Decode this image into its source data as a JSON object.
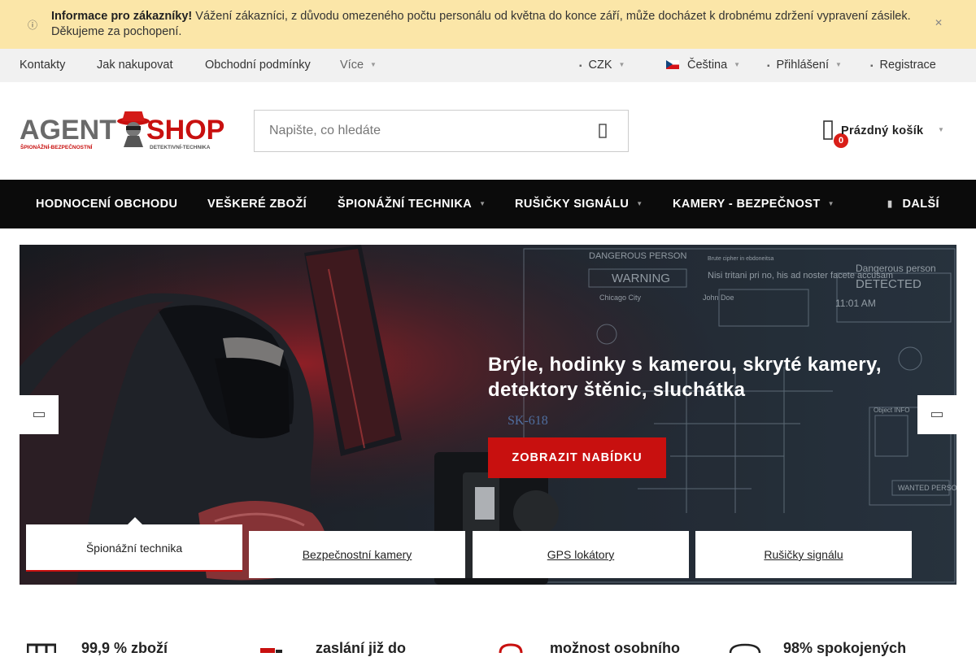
{
  "info_bar": {
    "title": "Informace pro zákazníky!",
    "message": "Vážení zákazníci, z důvodu omezeného počtu personálu od května do konce září, může docházet k drobnému zdržení vypravení zásilek. Děkujeme za pochopení.",
    "icon": "info-icon",
    "close_icon": "close-icon"
  },
  "top_links": {
    "contacts": "Kontakty",
    "how_to_buy": "Jak nakupovat",
    "terms": "Obchodní podmínky",
    "more": "Více",
    "currency": "CZK",
    "language": "Čeština",
    "login": "Přihlášení",
    "register": "Registrace"
  },
  "header": {
    "logo_left": "AGENT",
    "logo_right": "SHOP",
    "logo_tag_left": "ŠPIONÁŽNÍ-BEZPEČNOSTNÍ",
    "logo_tag_right": "DETEKTIVNÍ-TECHNIKA",
    "search_placeholder": "Napište, co hledáte",
    "cart_label": "Prázdný košík",
    "cart_count": "0"
  },
  "main_nav": {
    "items": [
      "HODNOCENÍ OBCHODU",
      "VEŠKERÉ ZBOŽÍ",
      "ŠPIONÁŽNÍ TECHNIKA",
      "RUŠIČKY SIGNÁLU",
      "KAMERY - BEZPEČNOST"
    ],
    "more": "DALŠÍ"
  },
  "hero": {
    "headline": "Brýle, hodinky s kamerou, skryté kamery, detektory štěnic, sluchátka",
    "cta": "ZOBRAZIT NABÍDKU",
    "image_texts": {
      "dangerous": "DANGEROUS PERSON",
      "warning": "WARNING",
      "detected_title": "Dangerous person",
      "detected": "DETECTED",
      "time": "11:01 AM",
      "obj_info": "Object INFO",
      "wanted": "WANTED PERSON",
      "device": "SK-618",
      "latin": "Nisi tritani pri no, his ad noster facete accusam",
      "city": "Chicago City",
      "name": "John Doe",
      "brute": "Brute cipher in ebdoneitsa"
    },
    "tabs": [
      "Špionážní technika",
      "Bezpečnostní kamery",
      "GPS lokátory",
      "Rušičky signálu"
    ]
  },
  "benefits": [
    "99,9 % zboží",
    "zaslání již do",
    "možnost osobního",
    "98% spokojených"
  ],
  "colors": {
    "accent": "#c8100f",
    "info_bg": "#fbe6a8",
    "nav_bg": "#0b0b0b"
  }
}
